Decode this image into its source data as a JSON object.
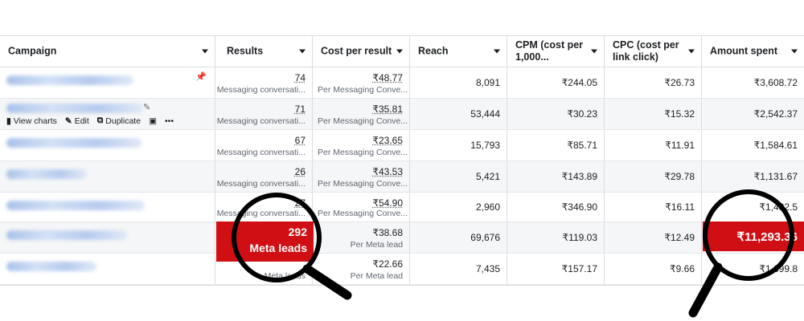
{
  "header": {
    "campaign": "Campaign",
    "results": "Results",
    "cost_per_result": "Cost per result",
    "reach": "Reach",
    "cpm": "CPM (cost per 1,000...",
    "cpc": "CPC (cost per link click)",
    "amount_spent": "Amount spent"
  },
  "row_actions": {
    "view_charts": "View charts",
    "edit": "Edit",
    "duplicate": "Duplicate",
    "more": "•••"
  },
  "rows": [
    {
      "results": "74",
      "results_sub": "Messaging conversati...",
      "cpr": "₹48.77",
      "cpr_sub": "Per Messaging Conve...",
      "reach": "8,091",
      "cpm": "₹244.05",
      "cpc": "₹26.73",
      "spent": "₹3,608.72"
    },
    {
      "results": "71",
      "results_sub": "Messaging conversati...",
      "cpr": "₹35.81",
      "cpr_sub": "Per Messaging Conve...",
      "reach": "53,444",
      "cpm": "₹30.23",
      "cpc": "₹15.32",
      "spent": "₹2,542.37"
    },
    {
      "results": "67",
      "results_sub": "Messaging conversati...",
      "cpr": "₹23.65",
      "cpr_sub": "Per Messaging Conve...",
      "reach": "15,793",
      "cpm": "₹85.71",
      "cpc": "₹11.91",
      "spent": "₹1,584.61"
    },
    {
      "results": "26",
      "results_sub": "Messaging conversati...",
      "cpr": "₹43.53",
      "cpr_sub": "Per Messaging Conve...",
      "reach": "5,421",
      "cpm": "₹143.89",
      "cpc": "₹29.78",
      "spent": "₹1,131.67"
    },
    {
      "results": "27",
      "results_sub": "Messaging conversati...",
      "cpr": "₹54.90",
      "cpr_sub": "Per Messaging Conve...",
      "reach": "2,960",
      "cpm": "₹346.90",
      "cpc": "₹16.11",
      "spent": "₹1,482.5"
    },
    {
      "results": "292",
      "results_sub": "Meta leads",
      "cpr": "₹38.68",
      "cpr_sub": "Per Meta lead",
      "reach": "69,676",
      "cpm": "₹119.03",
      "cpc": "₹12.49",
      "spent": "₹11,293.36"
    },
    {
      "results": "",
      "results_sub": "Meta leads",
      "cpr": "₹22.66",
      "cpr_sub": "Per Meta lead",
      "reach": "7,435",
      "cpm": "₹157.17",
      "cpc": "₹9.66",
      "spent": "₹1,699.8"
    }
  ],
  "highlight": {
    "results_value": "292",
    "results_label": "Meta leads",
    "spent_value": "₹11,293.36",
    "color": "#d00f14"
  },
  "colors": {
    "link_blue": "#1877f2",
    "border": "#dadde1",
    "muted": "#606770"
  }
}
